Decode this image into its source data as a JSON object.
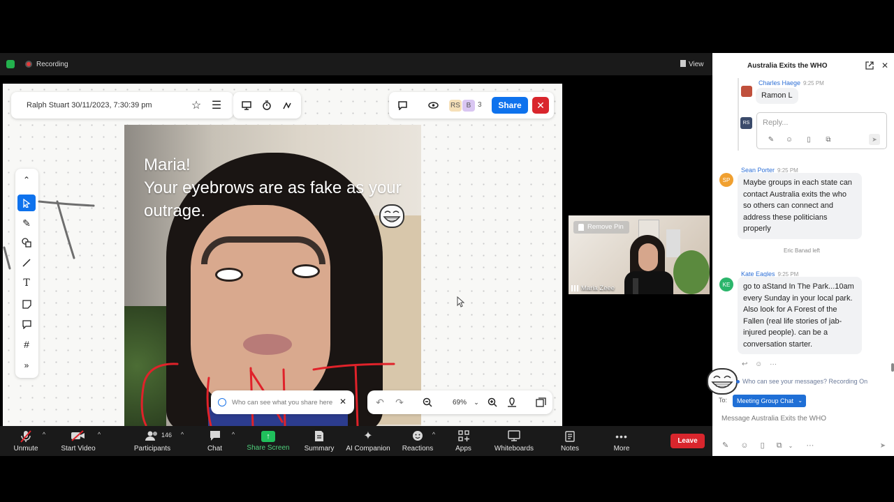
{
  "topbar": {
    "recording_label": "Recording",
    "view_label": "View"
  },
  "whiteboard": {
    "header_text": "Ralph Stuart 30/11/2023, 7:30:39 pm",
    "share_label": "Share",
    "collab_badges": [
      "RS",
      "B"
    ],
    "collab_count": "3",
    "meme_caption": "Maria!\nYour eyebrows are as fake as your outrage.",
    "visibility_hint": "Who can see what you share here",
    "zoom_level": "69%"
  },
  "video_tile": {
    "remove_pin_label": "Remove Pin",
    "participant_name": "Maria Zeee"
  },
  "toolbar": {
    "unmute": "Unmute",
    "start_video": "Start Video",
    "participants": "Participants",
    "participants_count": "146",
    "chat": "Chat",
    "share_screen": "Share Screen",
    "summary": "Summary",
    "ai_companion": "AI Companion",
    "reactions": "Reactions",
    "apps": "Apps",
    "whiteboards": "Whiteboards",
    "notes": "Notes",
    "more": "More",
    "leave": "Leave"
  },
  "chat": {
    "title": "Australia Exits the WHO",
    "thread": {
      "author": "Charles Haege",
      "time": "9:25 PM",
      "text": "Ramon L",
      "reply_placeholder": "Reply...",
      "reply_avatar": "RS"
    },
    "messages": [
      {
        "author": "Sean Porter",
        "time": "9:25 PM",
        "initials": "SP",
        "color": "#f0a030",
        "text": "Maybe groups in each state can contact Australia exits the who so others can connect and address these politicians properly"
      },
      {
        "author": "Kate Eagles",
        "time": "9:25 PM",
        "initials": "KE",
        "color": "#2bb56b",
        "text": "go to aStand In The Park...10am every Sunday in your local park. Also look for A Forest of the Fallen (real life stories of jab-injured people). can be a conversation starter."
      }
    ],
    "system_notice": "Eric Banad left",
    "visibility_notice": "Who can see your messages? Recording On",
    "to_label": "To:",
    "recipient": "Meeting Group Chat",
    "input_placeholder": "Message Australia Exits the WHO"
  },
  "colors": {
    "accent": "#0e72ed",
    "leave": "#d9262d",
    "share_screen": "#20c05c",
    "ink_red": "#e0222a"
  }
}
